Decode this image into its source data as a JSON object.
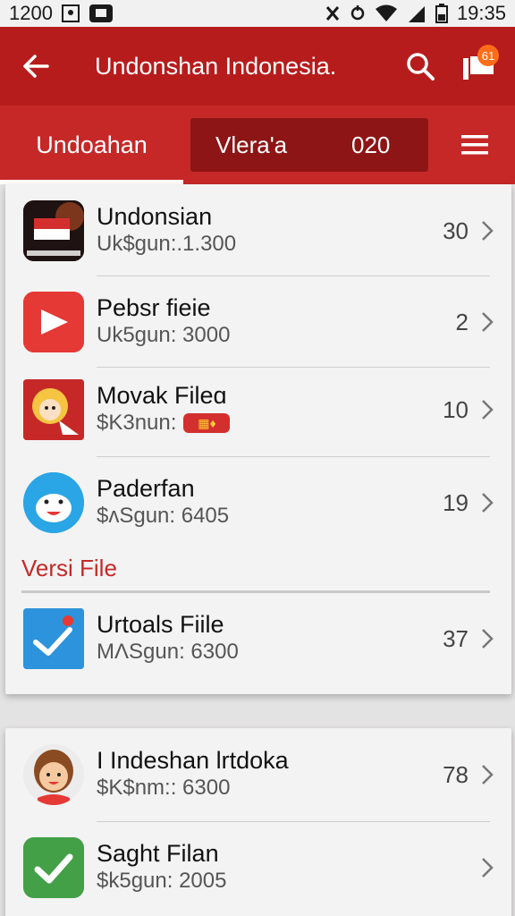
{
  "status_bar": {
    "time_left": "1200",
    "time_right": "19:35"
  },
  "header": {
    "title": "Undonshan Indonesia.",
    "notification_badge": "61"
  },
  "tabs": {
    "active": "Undoahan",
    "versi": "Vlera'a",
    "count": "020"
  },
  "section_label": "Versi File",
  "list_top": [
    {
      "title": "Undonsian",
      "subtitle": "Uk$gun:.1.300",
      "count": "30",
      "icon": "flag-icon"
    },
    {
      "title": "Pebsr fieie",
      "subtitle": "Uk5gun: 3000",
      "count": "2",
      "icon": "play-icon"
    },
    {
      "title": "Movak Fileɑ",
      "subtitle": "$K3nun:",
      "count": "10",
      "icon": "cartoon-icon"
    },
    {
      "title": "Paderfan",
      "subtitle": "$ʌSgun: 6405",
      "count": "19",
      "icon": "character-icon"
    }
  ],
  "list_middle": [
    {
      "title": "Urtoals Fiile",
      "subtitle": "MɅSgun: 6300",
      "count": "37",
      "icon": "check-location-icon"
    }
  ],
  "list_bottom": [
    {
      "title": "I Indeshan lrtdoka",
      "subtitle": "$K$nm:: 6300",
      "count": "78",
      "icon": "avatar-icon"
    },
    {
      "title": "Saght Filan",
      "subtitle": "$k5gun: 2005",
      "count": "",
      "icon": "check-icon"
    }
  ],
  "colors": {
    "primary": "#b71c1c",
    "tab_bar": "#c62828",
    "tab_group": "#8e1515",
    "accent_badge": "#ff6d1a"
  }
}
